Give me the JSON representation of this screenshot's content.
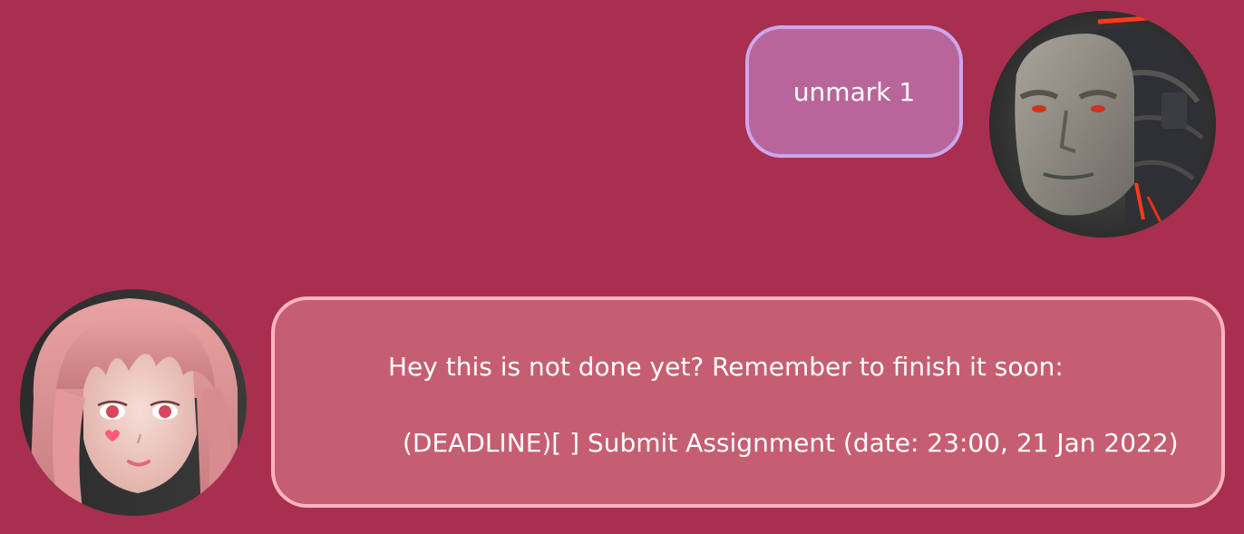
{
  "chat": {
    "messages": [
      {
        "sender": "user",
        "text": "unmark 1",
        "colors": {
          "bubble": "#b8669a",
          "border": "#cda6ee"
        },
        "avatar_icon": "cyborg-avatar-icon"
      },
      {
        "sender": "bot",
        "line1": "Hey this is not done yet? Remember to finish it soon:",
        "line2": "(DEADLINE)[ ] Submit Assignment (date: 23:00, 21 Jan 2022)",
        "colors": {
          "bubble": "#c65e72",
          "border": "#ffb3c1"
        },
        "avatar_icon": "anime-girl-avatar-icon"
      }
    ]
  },
  "theme": {
    "background": "#a82f4f",
    "text": "#ffffff"
  }
}
